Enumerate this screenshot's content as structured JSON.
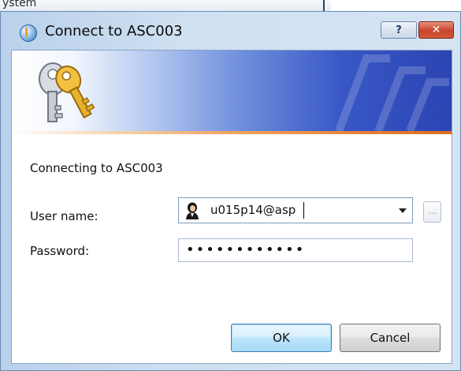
{
  "background_window": {
    "text": "ystem"
  },
  "dialog": {
    "title": "Connect to ASC003",
    "help_label": "?",
    "close_label": "✕"
  },
  "content": {
    "connecting_text": "Connecting to ASC003",
    "user_name_label": "User name:",
    "user_name_value": "u015p14@asp",
    "browse_label": "...",
    "password_label": "Password:",
    "password_mask": "••••••••••••"
  },
  "buttons": {
    "ok_label": "OK",
    "cancel_label": "Cancel"
  },
  "colors": {
    "banner_blue": "#2b45b3",
    "accent_orange": "#e58236",
    "close_red": "#c8442c"
  },
  "icons": {
    "title": "connection-globe-icon",
    "banner": "keys-icon",
    "user": "user-avatar-icon"
  }
}
